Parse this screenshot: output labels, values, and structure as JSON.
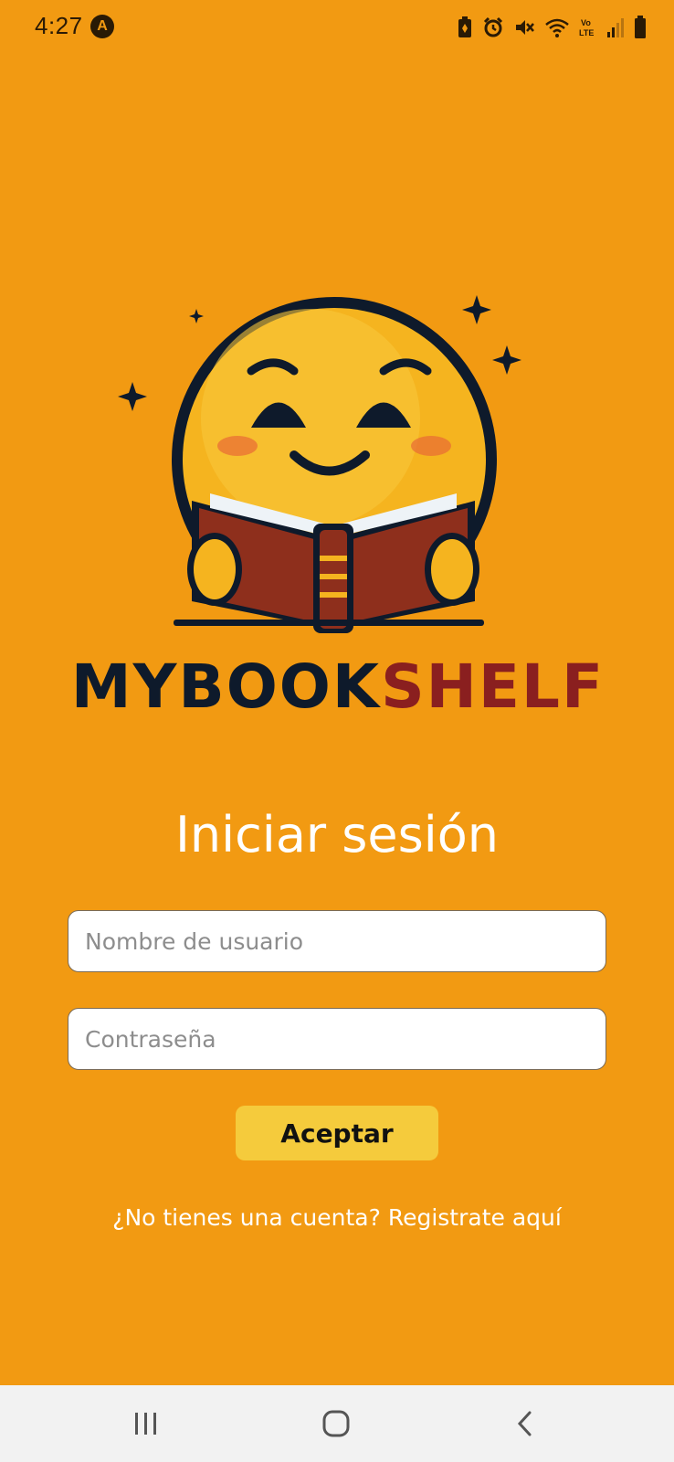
{
  "status_bar": {
    "time": "4:27",
    "app_icon": "A",
    "icons": [
      "battery-saver-icon",
      "alarm-icon",
      "mute-icon",
      "wifi-icon",
      "volte-icon",
      "signal-icon",
      "battery-icon"
    ],
    "volte_label": "Vo\nLTE"
  },
  "logo": {
    "brand_part1": "MYBOOK",
    "brand_part2": "SHELF",
    "colors": {
      "dark": "#0e1a2b",
      "accent": "#8a1f1f",
      "face": "#f5b41f"
    }
  },
  "login": {
    "title": "Iniciar sesión",
    "username_placeholder": "Nombre de usuario",
    "password_placeholder": "Contraseña",
    "accept_label": "Aceptar",
    "register_text": "¿No tienes una cuenta? Registrate aquí"
  },
  "nav_bar": {
    "items": [
      "recents-icon",
      "home-icon",
      "back-icon"
    ]
  },
  "colors": {
    "background": "#f29a12",
    "button": "#f5cb3c",
    "nav_bar": "#f2f2f2"
  }
}
